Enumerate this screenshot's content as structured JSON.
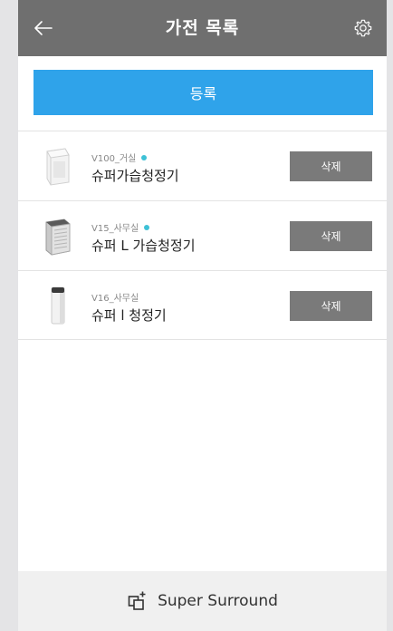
{
  "header": {
    "title": "가전 목록",
    "back_icon": "arrow-left-icon",
    "settings_icon": "gear-icon"
  },
  "register_button": {
    "label": "등록"
  },
  "devices": [
    {
      "model": "V100_거실",
      "online": true,
      "name": "슈퍼가습청정기",
      "delete_label": "삭제",
      "icon": "humidifier-purifier-icon"
    },
    {
      "model": "V15_사무실",
      "online": true,
      "name": "슈퍼 L 가습청정기",
      "delete_label": "삭제",
      "icon": "humidifier-purifier-icon"
    },
    {
      "model": "V16_사무실",
      "online": false,
      "name": "슈퍼 l 청정기",
      "delete_label": "삭제",
      "icon": "air-purifier-icon"
    }
  ],
  "footer": {
    "label": "Super Surround",
    "icon": "add-group-icon"
  },
  "colors": {
    "header_bg": "#6f6f6f",
    "accent": "#2fa3ea",
    "online_dot": "#3ec1d6",
    "delete_bg": "#7a7a7a",
    "footer_bg": "#f0f0f0"
  }
}
